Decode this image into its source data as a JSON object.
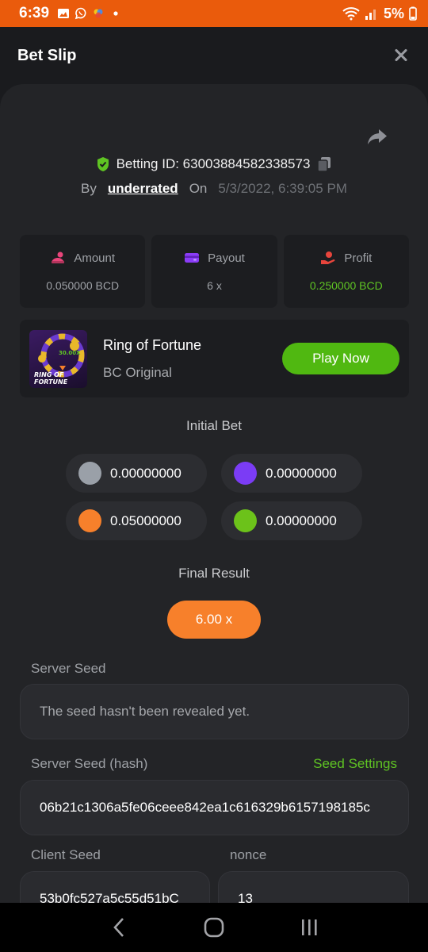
{
  "status_bar": {
    "time": "6:39",
    "battery": "5%"
  },
  "header": {
    "title": "Bet Slip"
  },
  "bet": {
    "betting_id_label": "Betting ID: 63003884582338573",
    "by_label": "By",
    "user": "underrated",
    "on_label": "On",
    "date": "5/3/2022, 6:39:05 PM"
  },
  "stats": [
    {
      "label": "Amount",
      "value": "0.050000 BCD",
      "color": "#e8457a"
    },
    {
      "label": "Payout",
      "value": "6 x",
      "color": "#8b3cf7"
    },
    {
      "label": "Profit",
      "value": "0.250000 BCD",
      "color": "#e8453c"
    }
  ],
  "game": {
    "name": "Ring of Fortune",
    "subtitle": "BC Original",
    "play_label": "Play Now",
    "thumb_multiplier": "30.00X",
    "thumb_title_line1": "RING OF",
    "thumb_title_line2": "FORTUNE"
  },
  "initial_bet": {
    "title": "Initial Bet",
    "chips": [
      {
        "value": "0.00000000",
        "color": "#9aa0a8"
      },
      {
        "value": "0.00000000",
        "color": "#7b3cf5"
      },
      {
        "value": "0.05000000",
        "color": "#f7802b"
      },
      {
        "value": "0.00000000",
        "color": "#6cc21a"
      }
    ]
  },
  "final_result": {
    "title": "Final Result",
    "value": "6.00 x"
  },
  "server_seed": {
    "label": "Server Seed",
    "value": "The seed hasn't been revealed yet."
  },
  "server_seed_hash": {
    "label": "Server Seed (hash)",
    "settings_label": "Seed Settings",
    "value": "06b21c1306a5fe06ceee842ea1c616329b6157198185c"
  },
  "client_seed": {
    "label": "Client Seed",
    "value": "53b0fc527a5c55d51bC"
  },
  "nonce": {
    "label": "nonce",
    "value": "13"
  },
  "colors": {
    "accent_green": "#5fc423",
    "orange": "#f7802b",
    "status_bar": "#ea5b0c"
  }
}
